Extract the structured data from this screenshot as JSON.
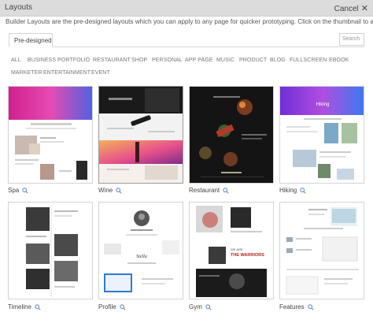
{
  "window": {
    "title": "Layouts",
    "cancel_label": "Cancel",
    "close_glyph": "✕"
  },
  "description": "Builder Layouts are the pre-designed layouts which you can apply to any page for quicker prototyping. Click on the thumbnail to apply.",
  "tab": {
    "label": "Pre-designed"
  },
  "search": {
    "placeholder": "Search"
  },
  "categories": [
    "ALL",
    "BUSINESS",
    "PORTFOLIO",
    "RESTAURANT",
    "SHOP",
    "PERSONAL",
    "APP PAGE",
    "MUSIC",
    "PRODUCT",
    "BLOG",
    "FULLSCREEN",
    "EBOOK",
    "MARKETER",
    "ENTERTAINMENT",
    "EVENT"
  ],
  "layouts": [
    {
      "name": "Spa",
      "theme": "spa"
    },
    {
      "name": "Wine",
      "theme": "wine"
    },
    {
      "name": "Restaurant",
      "theme": "restaurant"
    },
    {
      "name": "Hiking",
      "theme": "hiking"
    },
    {
      "name": "Timeline",
      "theme": "timeline"
    },
    {
      "name": "Profile",
      "theme": "profile"
    },
    {
      "name": "Gym",
      "theme": "gym"
    },
    {
      "name": "Features",
      "theme": "features"
    }
  ],
  "thumb_text": {
    "gym_headline": "THE WARRIORS",
    "gym_sub": "WE ARE",
    "profile_sign": "Stella",
    "hiking_header": "Hiking"
  },
  "colors": {
    "titlebar": "#dcdcdc",
    "card_border": "#d4d4d4",
    "hover_border": "#9a9a9a",
    "link_icon": "#6a8fd0"
  }
}
